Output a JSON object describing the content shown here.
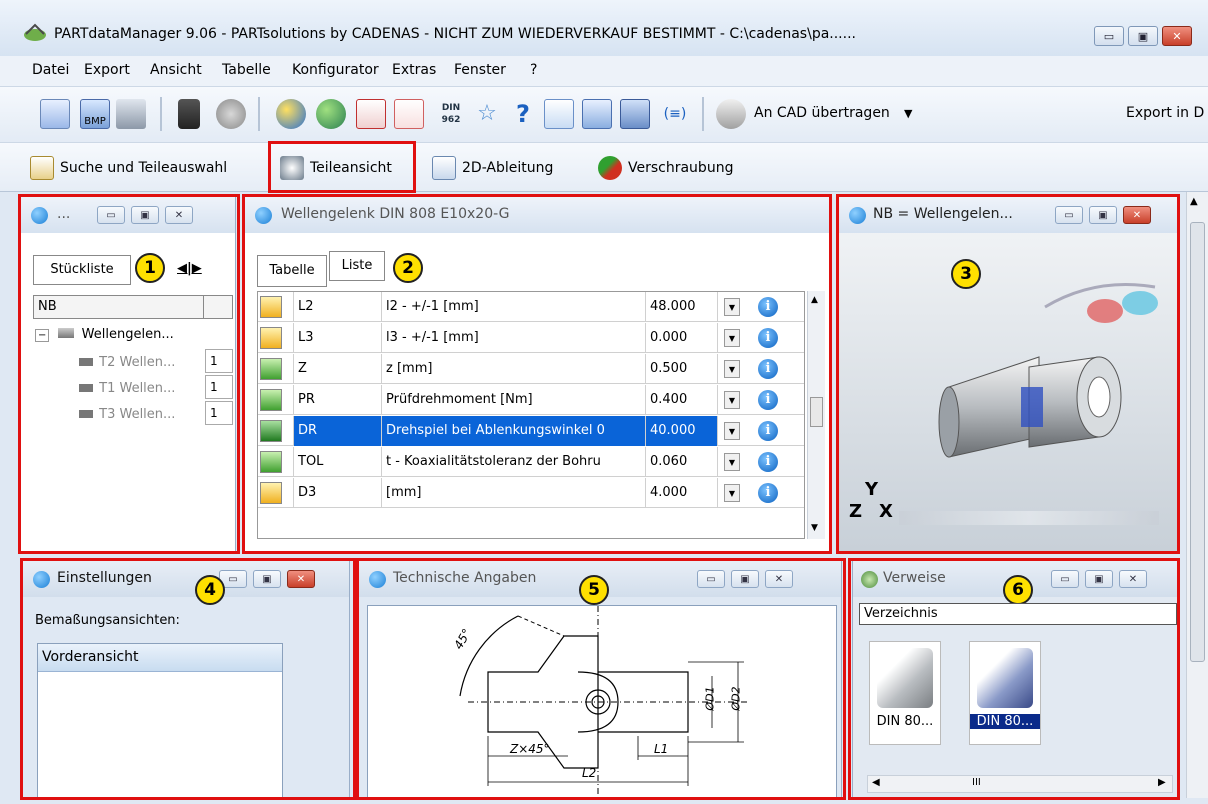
{
  "window": {
    "title": "PARTdataManager 9.06 - PARTsolutions by CADENAS - NICHT ZUM WIEDERVERKAUF BESTIMMT - C:\\cadenas\\pa......",
    "minimize": "▭",
    "maximize": "▣",
    "close": "✕"
  },
  "menu": [
    "Datei",
    "Export",
    "Ansicht",
    "Tabelle",
    "Konfigurator",
    "Extras",
    "Fenster",
    "?"
  ],
  "toolbar": {
    "bmp_label": "BMP",
    "din_label": "DIN 962",
    "help_label": "?",
    "bracket_label": "(≡)",
    "cad_transfer": "An CAD übertragen",
    "export_label": "Export in D",
    "dropdown_glyph": "▼"
  },
  "toolbar2": {
    "search": "Suche und Teileauswahl",
    "part_view": "Teileansicht",
    "derivation": "2D-Ableitung",
    "screwing": "Verschraubung"
  },
  "panel1": {
    "title": "...",
    "tab": "Stückliste",
    "badge": "1",
    "nav": "◀|▶",
    "header": "NB",
    "root": "Wellengelen...",
    "children": [
      {
        "label": "T2 Wellen...",
        "qty": "1"
      },
      {
        "label": "T1 Wellen...",
        "qty": "1"
      },
      {
        "label": "T3 Wellen...",
        "qty": "1"
      }
    ]
  },
  "panel2": {
    "title": "Wellengelenk DIN 808 E10x20-G",
    "tabs": [
      "Tabelle",
      "Liste"
    ],
    "badge": "2",
    "rows": [
      {
        "name": "L2",
        "desc": "l2 - +/-1 [mm]",
        "value": "48.000",
        "icon": "arrow"
      },
      {
        "name": "L3",
        "desc": "l3 - +/-1 [mm]",
        "value": "0.000",
        "icon": "arrow"
      },
      {
        "name": "Z",
        "desc": "z [mm]",
        "value": "0.500",
        "icon": "check"
      },
      {
        "name": "PR",
        "desc": "Prüfdrehmoment [Nm]",
        "value": "0.400",
        "icon": "check"
      },
      {
        "name": "DR",
        "desc": "Drehspiel bei Ablenkungswinkel 0",
        "value": "40.000",
        "icon": "filter"
      },
      {
        "name": "TOL",
        "desc": "t - Koaxialitätstoleranz der Bohru",
        "value": "0.060",
        "icon": "check"
      },
      {
        "name": "D3",
        "desc": "[mm]",
        "value": "4.000",
        "icon": "arrow"
      }
    ],
    "info_glyph": "i",
    "dd_glyph": "▼"
  },
  "panel3": {
    "title": "NB = Wellengelen...",
    "badge": "3",
    "axis_y": "Y",
    "axis_z": "Z",
    "axis_x": "X"
  },
  "panel4": {
    "title": "Einstellungen",
    "badge": "4",
    "label": "Bemaßungsansichten:",
    "item": "Vorderansicht"
  },
  "panel5": {
    "title": "Technische Angaben",
    "badge": "5",
    "dims": {
      "angle": "45°",
      "chamfer": "Z×45°",
      "l1": "L1",
      "l2": "L2",
      "d1": "ØD1",
      "d2": "ØD2"
    }
  },
  "panel6": {
    "title": "Verweise",
    "badge": "6",
    "select": "Verzeichnis",
    "items": [
      "DIN 80...",
      "DIN 80..."
    ],
    "scroll_label": "III"
  },
  "colors": {
    "highlight": "#0a64d8",
    "red_box": "#e01010",
    "badge": "#ffe000"
  }
}
